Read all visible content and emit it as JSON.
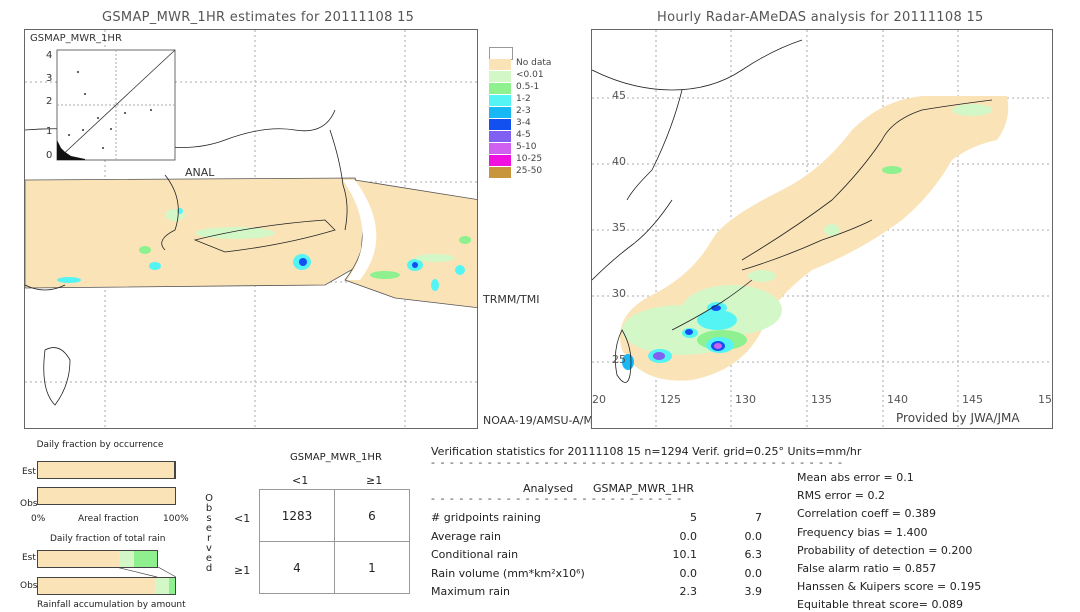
{
  "left_panel": {
    "title": "GSMAP_MWR_1HR estimates for 20111108 15",
    "inset_label": "GSMAP_MWR_1HR",
    "inset_axis_x_label": "ANAL",
    "inset_ticks": [
      "0",
      "1",
      "2",
      "3",
      "4"
    ],
    "sensor_labels": [
      "TRMM/TMI",
      "NOAA-19/AMSU-A/M"
    ]
  },
  "right_panel": {
    "title": "Hourly Radar-AMeDAS analysis for 20111108 15",
    "lat_ticks": [
      "45",
      "40",
      "35",
      "30",
      "25",
      "20"
    ],
    "lon_ticks": [
      "125",
      "130",
      "135",
      "140",
      "145",
      "15"
    ],
    "credit": "Provided by JWA/JMA"
  },
  "legend": {
    "items": [
      {
        "label": "",
        "color": "#ffffff"
      },
      {
        "label": "No data",
        "color": "#fbe3b8"
      },
      {
        "label": "<0.01",
        "color": "#d4f7c8"
      },
      {
        "label": "0.5-1",
        "color": "#8ef08e"
      },
      {
        "label": "1-2",
        "color": "#55f4f4"
      },
      {
        "label": "2-3",
        "color": "#18b8f4"
      },
      {
        "label": "3-4",
        "color": "#1250f0"
      },
      {
        "label": "4-5",
        "color": "#8060f0"
      },
      {
        "label": "5-10",
        "color": "#d060f0"
      },
      {
        "label": "10-25",
        "color": "#f010e0"
      },
      {
        "label": "25-50",
        "color": "#c8943c"
      }
    ]
  },
  "occurrence": {
    "title": "Daily fraction by occurrence",
    "rows": [
      "Est",
      "Obs"
    ],
    "axis_left": "0%",
    "axis_mid": "Areal fraction",
    "axis_right": "100%",
    "est_segments": [
      {
        "fraction": 0.995,
        "color": "#fbe3b8"
      },
      {
        "fraction": 0.005,
        "color": "#444444"
      }
    ],
    "obs_segments": [
      {
        "fraction": 1.0,
        "color": "#fbe3b8"
      }
    ]
  },
  "total_rain": {
    "title": "Daily fraction of total rain",
    "rows": [
      "Est",
      "Obs"
    ],
    "footer": "Rainfall accumulation by amount",
    "est_extent": 0.87,
    "est_segments": [
      {
        "fraction": 0.68,
        "color": "#fbe3b8"
      },
      {
        "fraction": 0.13,
        "color": "#d4f7c8"
      },
      {
        "fraction": 0.19,
        "color": "#8ef08e"
      }
    ],
    "obs_segments": [
      {
        "fraction": 0.855,
        "color": "#fbe3b8"
      },
      {
        "fraction": 0.1,
        "color": "#d4f7c8"
      },
      {
        "fraction": 0.045,
        "color": "#8ef08e"
      }
    ]
  },
  "contingency": {
    "title": "GSMAP_MWR_1HR",
    "col_headers": [
      "<1",
      "≥1"
    ],
    "row_headers": [
      "<1",
      "≥1"
    ],
    "side_label": "Observed",
    "cells": [
      [
        "1283",
        "6"
      ],
      [
        "4",
        "1"
      ]
    ]
  },
  "verification": {
    "header": "Verification statistics for 20111108 15   n=1294   Verif. grid=0.25°   Units=mm/hr",
    "col_analysed": "Analysed",
    "col_model": "GSMAP_MWR_1HR",
    "rows": [
      {
        "label": "# gridpoints raining",
        "analysed": "5",
        "model": "7"
      },
      {
        "label": "Average rain",
        "analysed": "0.0",
        "model": "0.0"
      },
      {
        "label": "Conditional rain",
        "analysed": "10.1",
        "model": "6.3"
      },
      {
        "label": "Rain volume (mm*km²x10⁶)",
        "analysed": "0.0",
        "model": "0.0"
      },
      {
        "label": "Maximum rain",
        "analysed": "2.3",
        "model": "3.9"
      }
    ],
    "scores": [
      "Mean abs error = 0.1",
      "RMS error = 0.2",
      "Correlation coeff = 0.389",
      "Frequency bias = 1.400",
      "Probability of detection = 0.200",
      "False alarm ratio = 0.857",
      "Hanssen & Kuipers score = 0.195",
      "Equitable threat score= 0.089"
    ]
  }
}
